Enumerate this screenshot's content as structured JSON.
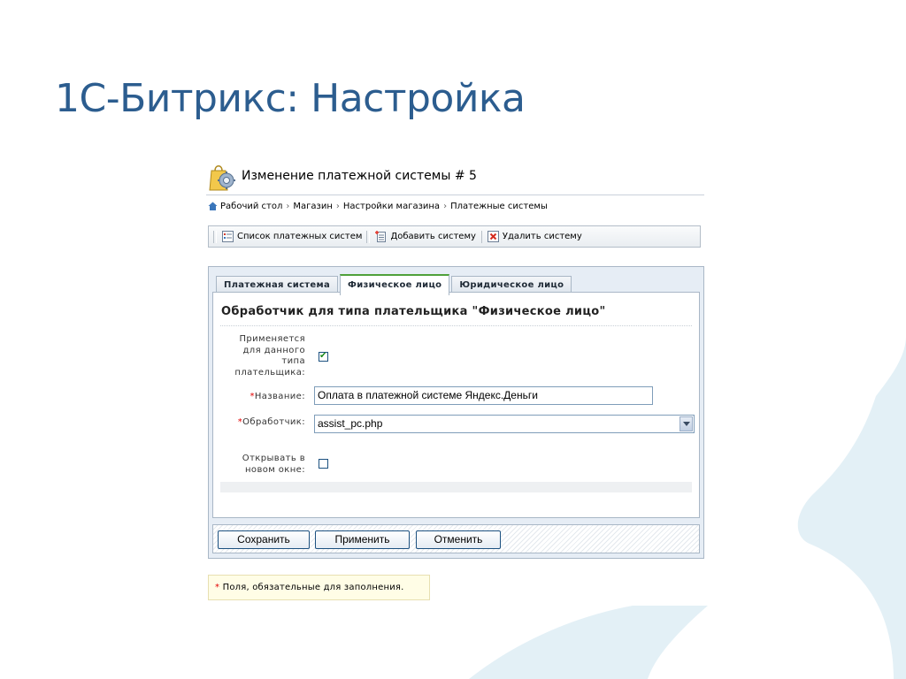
{
  "slide": {
    "title": "1С-Битрикс: Настройка",
    "accent_color": "#2c5d8f",
    "decoration_color": "#e3f0f6"
  },
  "page": {
    "title": "Изменение платежной системы # 5",
    "icon": "shop-settings-icon"
  },
  "breadcrumb": {
    "home_icon": "home-icon",
    "items": [
      "Рабочий стол",
      "Магазин",
      "Настройки магазина",
      "Платежные системы"
    ]
  },
  "toolbar": {
    "list_label": "Список платежных систем",
    "add_label": "Добавить систему",
    "delete_label": "Удалить систему"
  },
  "tabs": [
    {
      "label": "Платежная система",
      "active": false
    },
    {
      "label": "Физическое лицо",
      "active": true
    },
    {
      "label": "Юридическое лицо",
      "active": false
    }
  ],
  "form": {
    "section_title": "Обработчик для типа плательщика \"Физическое лицо\"",
    "applies_label_lines": [
      "Применяется",
      "для данного",
      "типа",
      "плательщика:"
    ],
    "applies_checked": true,
    "required_mark": "*",
    "name_label": "Название:",
    "name_value": "Оплата в платежной системе Яндекс.Деньги",
    "handler_label": "Обработчик:",
    "handler_value": "assist_pc.php",
    "new_window_label_lines": [
      "Открывать в",
      "новом окне:"
    ],
    "new_window_checked": false
  },
  "buttons": {
    "save": "Сохранить",
    "apply": "Применить",
    "cancel": "Отменить"
  },
  "required_note": {
    "mark": "*",
    "text": "Поля, обязательные для заполнения."
  }
}
